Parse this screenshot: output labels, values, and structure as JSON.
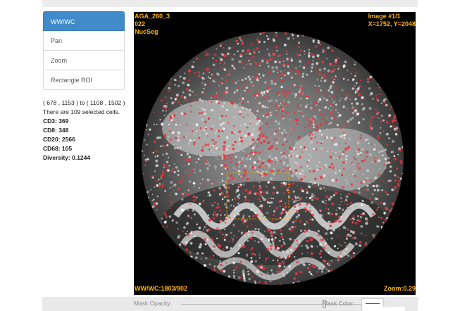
{
  "tools": [
    {
      "label": "WW/WC",
      "active": true
    },
    {
      "label": "Pan",
      "active": false
    },
    {
      "label": "Zoom",
      "active": false
    },
    {
      "label": "Rectangle ROI",
      "active": false
    }
  ],
  "selection": {
    "range": "( 678 , 1153 ) to ( 1108 , 1502 )",
    "count_text": "There are 109 selected cells.",
    "stats": [
      {
        "label": "CD3: 369"
      },
      {
        "label": "CD8: 348"
      },
      {
        "label": "CD20: 2566"
      },
      {
        "label": "CD68: 105"
      },
      {
        "label": "Diversity: 0.1244"
      }
    ]
  },
  "viewer": {
    "top_left": [
      "AGA_260_3",
      "022",
      "NucSeg"
    ],
    "top_right": [
      "Image #1/1",
      "X=1752, Y=2048"
    ],
    "bottom_left": "WW/WC:1803/902",
    "bottom_right": "Zoom:0.29",
    "overlay_color": "#ffb400",
    "cell_color": "#e8343b"
  },
  "controls": {
    "mask_opacity_label": "Mask Opacity:",
    "mask_opacity_value": 0.78,
    "mask_color_label": "Mask Color:"
  }
}
